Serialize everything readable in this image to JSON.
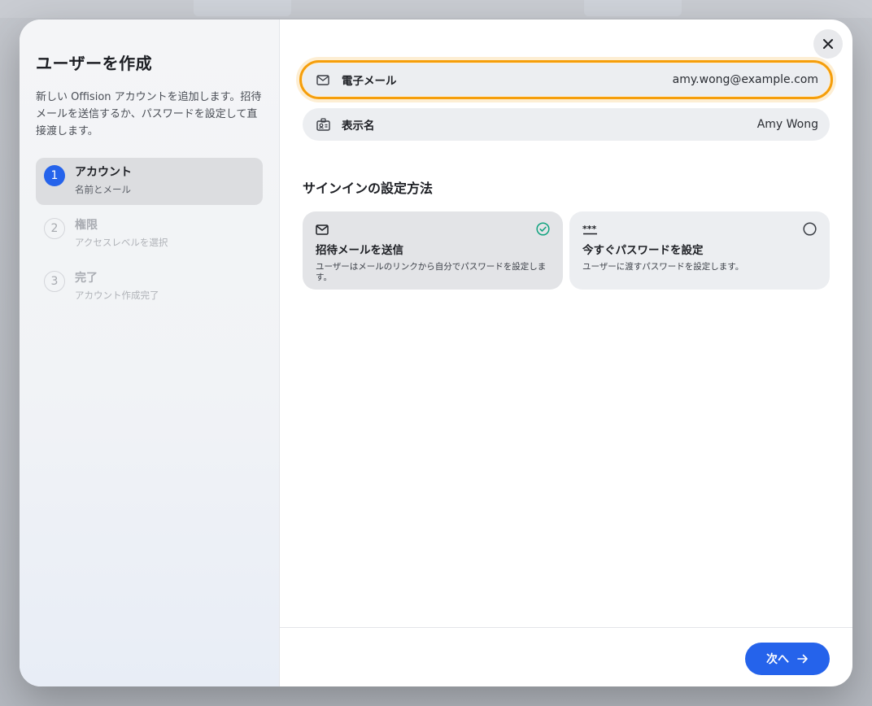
{
  "dialog": {
    "title": "ユーザーを作成",
    "description": "新しい Offision アカウントを追加します。招待メールを送信するか、パスワードを設定して直接渡します。"
  },
  "steps": [
    {
      "number": "1",
      "title": "アカウント",
      "subtitle": "名前とメール",
      "active": true
    },
    {
      "number": "2",
      "title": "権限",
      "subtitle": "アクセスレベルを選択",
      "active": false
    },
    {
      "number": "3",
      "title": "完了",
      "subtitle": "アカウント作成完了",
      "active": false
    }
  ],
  "fields": {
    "email": {
      "label": "電子メール",
      "value": "amy.wong@example.com",
      "icon": "mail-icon"
    },
    "display_name": {
      "label": "表示名",
      "value": "Amy Wong",
      "icon": "id-card-icon"
    }
  },
  "signin": {
    "title": "サインインの設定方法",
    "options": [
      {
        "title": "招待メールを送信",
        "description": "ユーザーはメールのリンクから自分でパスワードを設定します。",
        "icon": "mail-icon",
        "selected": true
      },
      {
        "title": "今すぐパスワードを設定",
        "description": "ユーザーに渡すパスワードを設定します。",
        "icon": "password-icon",
        "selected": false
      }
    ]
  },
  "footer": {
    "next_label": "次へ"
  },
  "colors": {
    "accent": "#2563eb",
    "focus": "#f59e0b",
    "check": "#10a37f"
  }
}
